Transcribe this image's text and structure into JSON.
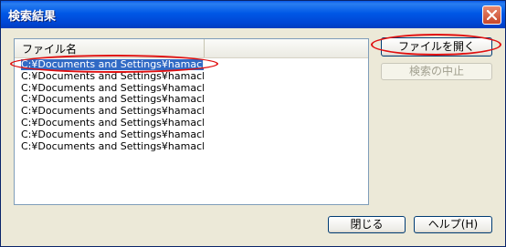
{
  "window": {
    "title": "検索結果"
  },
  "list": {
    "column_header": "ファイル名",
    "rows": [
      "C:¥Documents and Settings¥hamacha...",
      "C:¥Documents and Settings¥hamacha...",
      "C:¥Documents and Settings¥hamacha...",
      "C:¥Documents and Settings¥hamacha...",
      "C:¥Documents and Settings¥hamacha...",
      "C:¥Documents and Settings¥hamacha...",
      "C:¥Documents and Settings¥hamacha...",
      "C:¥Documents and Settings¥hamacha..."
    ],
    "selected_index": 0
  },
  "buttons": {
    "open_file": "ファイルを開く",
    "stop_search": "検索の中止",
    "close": "閉じる",
    "help": "ヘルプ(H)"
  },
  "icons": {
    "close": "close-icon"
  },
  "colors": {
    "title_bar": "#0054e3",
    "selection": "#316ac5",
    "annotation": "#e01010"
  }
}
